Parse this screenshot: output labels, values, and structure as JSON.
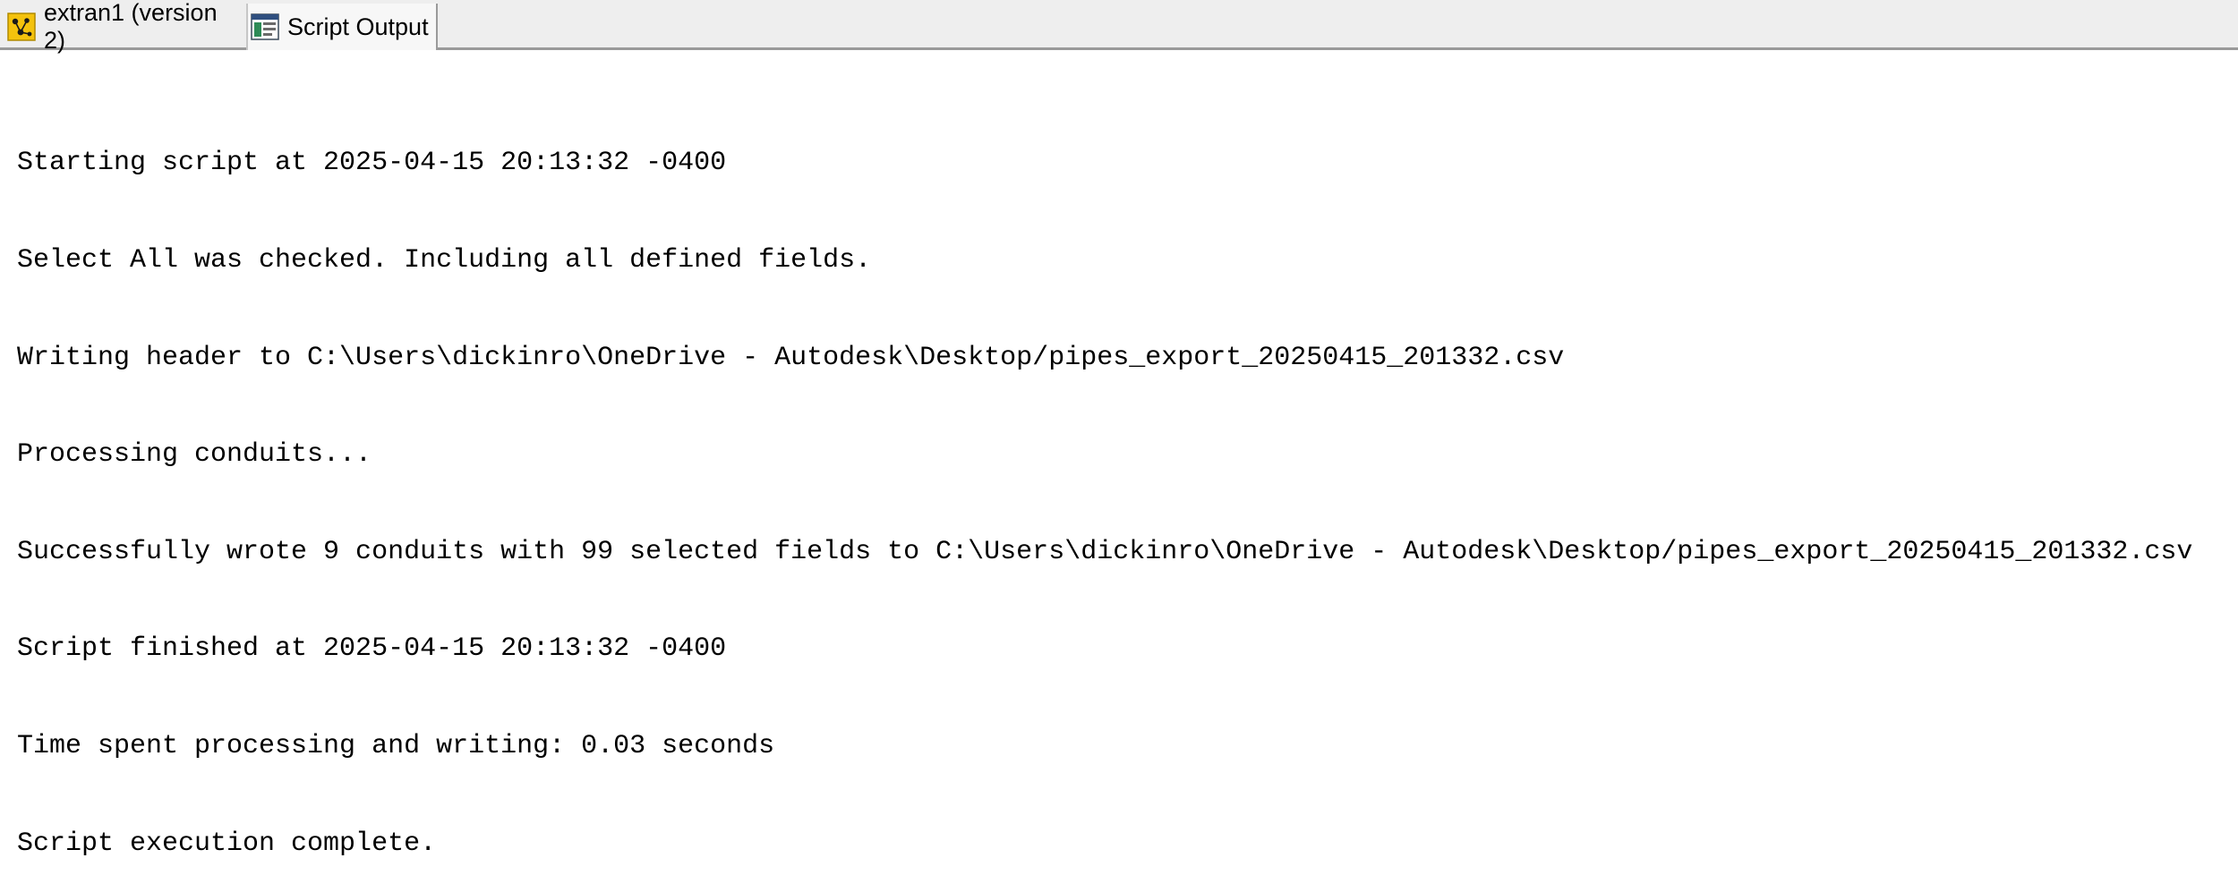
{
  "tabs": [
    {
      "label": "extran1 (version 2)",
      "icon": "model-network-icon"
    },
    {
      "label": "Script Output",
      "icon": "script-output-icon"
    }
  ],
  "colors": {
    "tabbar_bg": "#eeeeee",
    "tabbar_border": "#9a9a9a",
    "output_text": "#000000",
    "output_bg": "#ffffff"
  },
  "output": {
    "lines": [
      "Starting script at 2025-04-15 20:13:32 -0400",
      "Select All was checked. Including all defined fields.",
      "Writing header to C:\\Users\\dickinro\\OneDrive - Autodesk\\Desktop/pipes_export_20250415_201332.csv",
      "Processing conduits...",
      "Successfully wrote 9 conduits with 99 selected fields to C:\\Users\\dickinro\\OneDrive - Autodesk\\Desktop/pipes_export_20250415_201332.csv",
      "Script finished at 2025-04-15 20:13:32 -0400",
      "Time spent processing and writing: 0.03 seconds",
      "Script execution complete."
    ]
  }
}
